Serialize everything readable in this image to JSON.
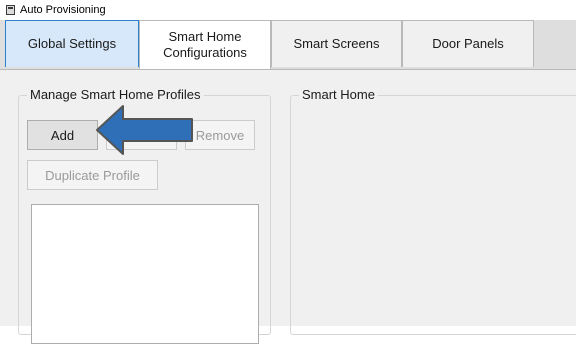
{
  "window": {
    "title": "Auto Provisioning"
  },
  "tabs": [
    {
      "label": "Global Settings",
      "state": "active"
    },
    {
      "label": "Smart Home\nConfigurations",
      "state": "selected"
    },
    {
      "label": "Smart Screens",
      "state": "normal"
    },
    {
      "label": "Door Panels",
      "state": "normal"
    }
  ],
  "profiles_group": {
    "title": "Manage Smart Home Profiles",
    "add_label": "Add",
    "remove_label": "Remove",
    "duplicate_label": "Duplicate Profile"
  },
  "smart_home_group": {
    "title": "Smart Home"
  },
  "annotation": {
    "arrow_color": "#2f6fb7",
    "arrow_outline": "#555555",
    "direction": "left"
  }
}
